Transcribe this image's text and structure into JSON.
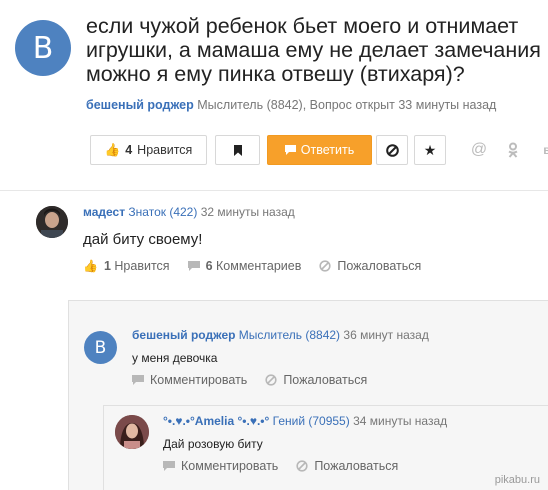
{
  "question": {
    "avatar_letter": "B",
    "title_lines": [
      "если чужой ребенок бьет моего и отнимает",
      "игрушки, а мамаша ему не делает замечания",
      "можно я ему пинка отвешу (втихаря)?"
    ],
    "author": "бешеный роджер",
    "author_rank": "Мыслитель (8842), Вопрос открыт 33 минуты назад"
  },
  "toolbar": {
    "like_count": "4",
    "like_label": "Нравится",
    "answer_label": "Ответить"
  },
  "answer": {
    "author": "мадест",
    "rank": "Знаток (422)",
    "time": "32 минуты назад",
    "text": "дай биту своему!",
    "like_count": "1",
    "like_label": "Нравится",
    "comments_count": "6",
    "comments_label": "Комментариев",
    "report_label": "Пожаловаться"
  },
  "comments": [
    {
      "avatar_letter": "B",
      "author": "бешеный роджер",
      "rank": "Мыслитель (8842)",
      "time": "36 минут назад",
      "text": "у меня девочка",
      "comment_label": "Комментировать",
      "report_label": "Пожаловаться"
    },
    {
      "author": "°•.♥.•°Amelia °•.♥.•°",
      "rank": "Гений (70955)",
      "time": "34 минуты назад",
      "text": "Дай розовую биту",
      "comment_label": "Комментировать",
      "report_label": "Пожаловаться"
    }
  ],
  "watermark": "pikabu.ru",
  "colors": {
    "link": "#3a70b8",
    "accent": "#f7a02a",
    "avatar": "#4e82c0"
  }
}
